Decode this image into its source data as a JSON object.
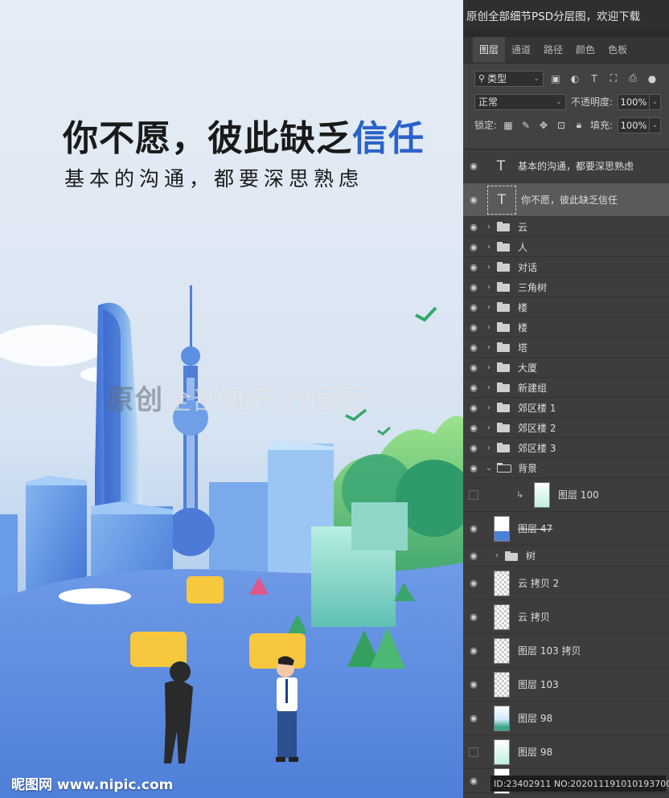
{
  "poster": {
    "headline_main": "你不愿，彼此缺乏",
    "headline_accent": "信任",
    "subline": "基本的沟通，都要深思熟虑",
    "watermark_bold": "原创",
    "watermark_rest": "全部细节分层图",
    "brand": "昵图网 www.nipic.com",
    "colors": {
      "accent": "#2b62c9",
      "sky": "#e6ecf5",
      "ground": "#5b8ee0"
    }
  },
  "panel": {
    "top_banner": "原创全部细节PSD分层图，欢迎下载",
    "tabs": [
      "图层",
      "通道",
      "路径",
      "颜色",
      "色板"
    ],
    "filter": {
      "label": "类型",
      "icon": "search-icon"
    },
    "blend_mode": "正常",
    "opacity_label": "不透明度:",
    "opacity_value": "100%",
    "lock_label": "锁定:",
    "fill_label": "填充:",
    "fill_value": "100%",
    "layers": [
      {
        "type": "text",
        "name": "基本的沟通，都要深思熟虑",
        "visible": true
      },
      {
        "type": "text",
        "name": "你不愿，彼此缺乏信任",
        "visible": true,
        "selected": true
      },
      {
        "type": "folder",
        "name": "云",
        "visible": true
      },
      {
        "type": "folder",
        "name": "人",
        "visible": true
      },
      {
        "type": "folder",
        "name": "对话",
        "visible": true
      },
      {
        "type": "folder",
        "name": "三角树",
        "visible": true
      },
      {
        "type": "folder",
        "name": "楼",
        "visible": true
      },
      {
        "type": "folder",
        "name": "楼",
        "visible": true
      },
      {
        "type": "folder",
        "name": "塔",
        "visible": true
      },
      {
        "type": "folder",
        "name": "大厦",
        "visible": true
      },
      {
        "type": "folder",
        "name": "新建组",
        "visible": true
      },
      {
        "type": "folder",
        "name": "郊区楼 1",
        "visible": true
      },
      {
        "type": "folder",
        "name": "郊区楼 2",
        "visible": true
      },
      {
        "type": "folder",
        "name": "郊区楼 3",
        "visible": true
      },
      {
        "type": "folder-open",
        "name": "背景",
        "visible": true
      },
      {
        "type": "layer",
        "name": "图层 100",
        "visible": false,
        "thumb": "mint",
        "clipped": true
      },
      {
        "type": "layer",
        "name": "图层 47",
        "visible": true,
        "thumb": "blue",
        "strike": true
      },
      {
        "type": "folder",
        "name": "树",
        "visible": true,
        "indent": true
      },
      {
        "type": "layer",
        "name": "云 拷贝 2",
        "visible": true,
        "thumb": "trans"
      },
      {
        "type": "layer",
        "name": "云 拷贝",
        "visible": true,
        "thumb": "trans"
      },
      {
        "type": "layer",
        "name": "图层 103 拷贝",
        "visible": true,
        "thumb": "trans"
      },
      {
        "type": "layer",
        "name": "图层 103",
        "visible": true,
        "thumb": "trans"
      },
      {
        "type": "layer",
        "name": "图层 98",
        "visible": true,
        "thumb": "green"
      },
      {
        "type": "layer",
        "name": "图层 98",
        "visible": false,
        "thumb": "mint"
      },
      {
        "type": "layer",
        "name": "背景",
        "visible": true,
        "thumb": "white"
      }
    ],
    "id_bar": "ID:23402911 NO:20201119101019370000"
  }
}
